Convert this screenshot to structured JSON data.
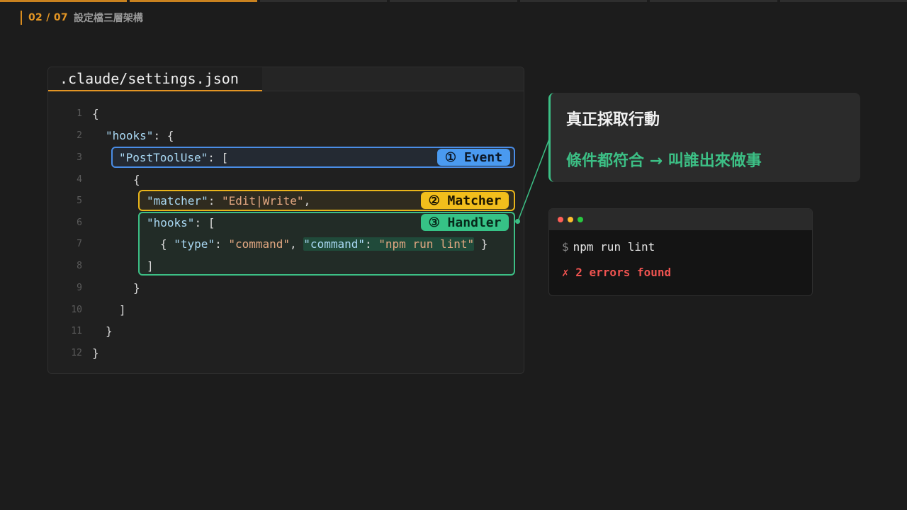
{
  "slide": {
    "counter": "02 / 07",
    "title": "設定檔三層架構"
  },
  "editor": {
    "filename": ".claude/settings.json",
    "lines": [
      {
        "n": "1"
      },
      {
        "n": "2"
      },
      {
        "n": "3"
      },
      {
        "n": "4"
      },
      {
        "n": "5"
      },
      {
        "n": "6"
      },
      {
        "n": "7"
      },
      {
        "n": "8"
      },
      {
        "n": "9"
      },
      {
        "n": "10"
      },
      {
        "n": "11"
      },
      {
        "n": "12"
      }
    ],
    "code": {
      "l1": "{",
      "l2_key": "\"hooks\"",
      "l2_rest": ": {",
      "l3_key": "\"PostToolUse\"",
      "l3_rest": ": [",
      "l4": "{",
      "l5_key": "\"matcher\"",
      "l5_colon": ": ",
      "l5_val": "\"Edit|Write\"",
      "l5_end": ",",
      "l6_key": "\"hooks\"",
      "l6_rest": ": [",
      "l7_open": "{ ",
      "l7_key1": "\"type\"",
      "l7_colon1": ": ",
      "l7_val1": "\"command\"",
      "l7_comma": ", ",
      "l7_key2": "\"command\"",
      "l7_colon2": ": ",
      "l7_val2": "\"npm run lint\"",
      "l7_close": " }",
      "l8": "]",
      "l9": "}",
      "l10": "]",
      "l11": "}",
      "l12": "}"
    },
    "badges": {
      "event": "① Event",
      "matcher": "② Matcher",
      "handler": "③ Handler"
    }
  },
  "callout": {
    "title": "真正採取行動",
    "subtitle": "條件都符合 → 叫誰出來做事"
  },
  "terminal": {
    "prompt": "$",
    "command": "npm run lint",
    "output": "✗ 2 errors found"
  },
  "colors": {
    "event": "#4a8de6",
    "matcher": "#e9b51a",
    "handler": "#3cbf85",
    "accent": "#e39524",
    "error": "#ef5350"
  }
}
